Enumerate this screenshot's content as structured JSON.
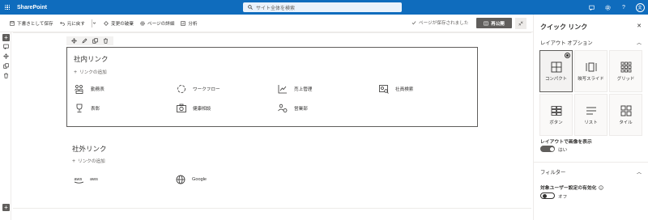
{
  "suitebar": {
    "brand": "SharePoint",
    "search_placeholder": "サイト全体を検索",
    "icons": [
      "chat-icon",
      "gear-icon",
      "help-icon",
      "user-avatar-icon"
    ]
  },
  "cmdbar": {
    "save_draft": "下書きとして保存",
    "undo": "元に戻す",
    "discard": "変更の破棄",
    "page_details": "ページの詳細",
    "analytics": "分析",
    "saved_status": "ページが保存されました",
    "republish": "再公開"
  },
  "webpart": {
    "title": "社内リンク",
    "add_link": "リンクの追加",
    "links": [
      {
        "label": "勤務表",
        "icon": "people-grid-icon"
      },
      {
        "label": "ワークフロー",
        "icon": "cycle-icon"
      },
      {
        "label": "売上管理",
        "icon": "chart-up-icon"
      },
      {
        "label": "社員検索",
        "icon": "id-search-icon"
      },
      {
        "label": "表彰",
        "icon": "trophy-icon"
      },
      {
        "label": "健康相談",
        "icon": "camera-icon"
      },
      {
        "label": "営業部",
        "icon": "team-icon"
      }
    ]
  },
  "external": {
    "title": "社外リンク",
    "add_link": "リンクの追加",
    "links": [
      {
        "label": "aws",
        "icon": "aws-logo-icon"
      },
      {
        "label": "Google",
        "icon": "globe-icon"
      }
    ]
  },
  "panel": {
    "title": "クイック リンク",
    "layout_section": "レイアウト オプション",
    "layouts": [
      {
        "label": "コンパクト",
        "selected": true
      },
      {
        "label": "映写スライド",
        "selected": false
      },
      {
        "label": "グリッド",
        "selected": false
      },
      {
        "label": "ボタン",
        "selected": false
      },
      {
        "label": "リスト",
        "selected": false
      },
      {
        "label": "タイル",
        "selected": false
      }
    ],
    "show_images_label": "レイアウトで画像を表示",
    "show_images_value": "はい",
    "filter_section": "フィルター",
    "audience_label": "対象ユーザー設定の有効化",
    "audience_value": "オフ"
  },
  "colors": {
    "suitebar": "#0f6cbd",
    "neutral_dark": "#605e5c",
    "text": "#323130"
  }
}
